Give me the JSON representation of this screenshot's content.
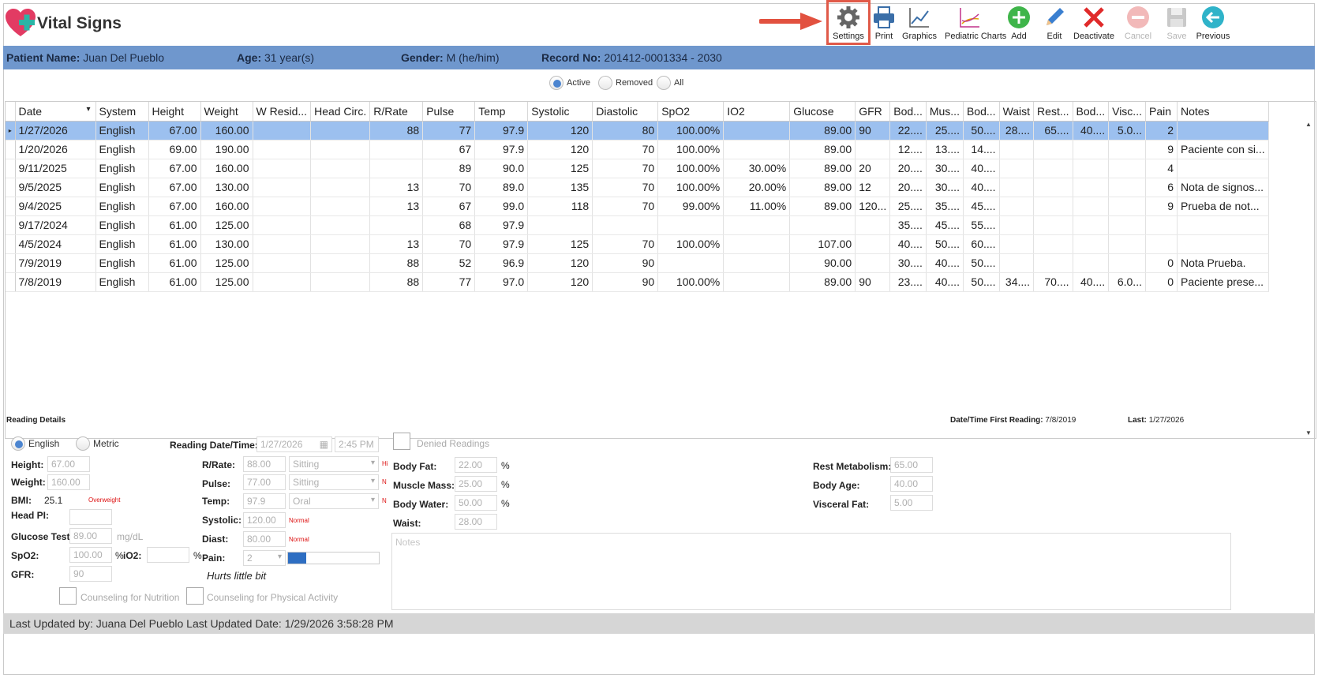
{
  "app": {
    "title": "Vital Signs"
  },
  "toolbar": [
    {
      "label": "Settings",
      "icon": "gear-icon",
      "disabled": false
    },
    {
      "label": "Print",
      "icon": "printer-icon",
      "disabled": false
    },
    {
      "label": "Graphics",
      "icon": "line-chart-icon",
      "disabled": false
    },
    {
      "label": "Pediatric Charts",
      "icon": "pediatric-chart-icon",
      "disabled": false
    },
    {
      "label": "Add",
      "icon": "plus-icon",
      "disabled": false
    },
    {
      "label": "Edit",
      "icon": "pencil-icon",
      "disabled": false
    },
    {
      "label": "Deactivate",
      "icon": "x-icon",
      "disabled": false
    },
    {
      "label": "Cancel",
      "icon": "minus-circle-icon",
      "disabled": true
    },
    {
      "label": "Save",
      "icon": "floppy-icon",
      "disabled": true
    },
    {
      "label": "Previous",
      "icon": "arrow-left-icon",
      "disabled": false
    }
  ],
  "patient": {
    "name_label": "Patient Name:",
    "name": "Juan Del Pueblo",
    "age_label": "Age:",
    "age": "31 year(s)",
    "gender_label": "Gender:",
    "gender": "M (he/him)",
    "record_label": "Record No:",
    "record": "201412-0001334 - 2030"
  },
  "filter": {
    "active": "Active",
    "removed": "Removed",
    "all": "All",
    "selected": "Active"
  },
  "grid": {
    "columns": [
      "Date",
      "System",
      "Height",
      "Weight",
      "W Resid...",
      "Head Circ.",
      "R/Rate",
      "Pulse",
      "Temp",
      "Systolic",
      "Diastolic",
      "SpO2",
      "IO2",
      "Glucose",
      "GFR",
      "Bod...",
      "Mus...",
      "Bod...",
      "Waist",
      "Rest...",
      "Bod...",
      "Visc...",
      "Pain",
      "Notes"
    ],
    "rows": [
      [
        "1/27/2026",
        "English",
        "67.00",
        "160.00",
        "",
        "",
        "88",
        "77",
        "97.9",
        "120",
        "80",
        "100.00%",
        "",
        "89.00",
        "90",
        "22....",
        "25....",
        "50....",
        "28....",
        "65....",
        "40....",
        "5.0...",
        "2",
        ""
      ],
      [
        "1/20/2026",
        "English",
        "69.00",
        "190.00",
        "",
        "",
        "",
        "67",
        "97.9",
        "120",
        "70",
        "100.00%",
        "",
        "89.00",
        "",
        "12....",
        "13....",
        "14....",
        "",
        "",
        "",
        "",
        "9",
        "Paciente con si..."
      ],
      [
        "9/11/2025",
        "English",
        "67.00",
        "160.00",
        "",
        "",
        "",
        "89",
        "90.0",
        "125",
        "70",
        "100.00%",
        "30.00%",
        "89.00",
        "20",
        "20....",
        "30....",
        "40....",
        "",
        "",
        "",
        "",
        "4",
        ""
      ],
      [
        "9/5/2025",
        "English",
        "67.00",
        "130.00",
        "",
        "",
        "13",
        "70",
        "89.0",
        "135",
        "70",
        "100.00%",
        "20.00%",
        "89.00",
        "12",
        "20....",
        "30....",
        "40....",
        "",
        "",
        "",
        "",
        "6",
        "Nota de signos..."
      ],
      [
        "9/4/2025",
        "English",
        "67.00",
        "160.00",
        "",
        "",
        "13",
        "67",
        "99.0",
        "118",
        "70",
        "99.00%",
        "11.00%",
        "89.00",
        "120...",
        "25....",
        "35....",
        "45....",
        "",
        "",
        "",
        "",
        "9",
        "Prueba de not..."
      ],
      [
        "9/17/2024",
        "English",
        "61.00",
        "125.00",
        "",
        "",
        "",
        "68",
        "97.9",
        "",
        "",
        "",
        "",
        "",
        "",
        "35....",
        "45....",
        "55....",
        "",
        "",
        "",
        "",
        "",
        ""
      ],
      [
        "4/5/2024",
        "English",
        "61.00",
        "130.00",
        "",
        "",
        "13",
        "70",
        "97.9",
        "125",
        "70",
        "100.00%",
        "",
        "107.00",
        "",
        "40....",
        "50....",
        "60....",
        "",
        "",
        "",
        "",
        "",
        ""
      ],
      [
        "7/9/2019",
        "English",
        "61.00",
        "125.00",
        "",
        "",
        "88",
        "52",
        "96.9",
        "120",
        "90",
        "",
        "",
        "90.00",
        "",
        "30....",
        "40....",
        "50....",
        "",
        "",
        "",
        "",
        "0",
        "Nota Prueba."
      ],
      [
        "7/8/2019",
        "English",
        "61.00",
        "125.00",
        "",
        "",
        "88",
        "77",
        "97.0",
        "120",
        "90",
        "100.00%",
        "",
        "89.00",
        "90",
        "23....",
        "40....",
        "50....",
        "34....",
        "70....",
        "40....",
        "6.0...",
        "0",
        "Paciente prese..."
      ]
    ]
  },
  "details": {
    "section_title": "Reading Details",
    "first_reading_label": "Date/Time First Reading:",
    "first_reading": "7/8/2019",
    "last_label": "Last:",
    "last": "1/27/2026",
    "system_english": "English",
    "system_metric": "Metric",
    "reading_dt_label": "Reading Date/Time:",
    "reading_date": "1/27/2026",
    "reading_time": "2:45 PM",
    "denied": "Denied Readings",
    "height_label": "Height:",
    "height": "67.00",
    "weight_label": "Weight:",
    "weight": "160.00",
    "bmi_label": "BMI:",
    "bmi": "25.1",
    "bmi_status": "Overweight",
    "headpi_label": "Head PI:",
    "glucose_label": "Glucose Test:",
    "glucose": "89.00",
    "glucose_unit": "mg/dL",
    "spo2_label": "SpO2:",
    "spo2": "100.00",
    "pct": "%",
    "io2_label": "iO2:",
    "gfr_label": "GFR:",
    "gfr": "90",
    "rrate_label": "R/Rate:",
    "rrate": "88.00",
    "rrate_pos": "Sitting",
    "rrate_flag": "Hi",
    "pulse_label": "Pulse:",
    "pulse": "77.00",
    "pulse_pos": "Sitting",
    "pulse_flag": "N",
    "temp_label": "Temp:",
    "temp": "97.9",
    "temp_route": "Oral",
    "temp_flag": "N",
    "systolic_label": "Systolic:",
    "systolic": "120.00",
    "systolic_status": "Normal",
    "diast_label": "Diast:",
    "diast": "80.00",
    "diast_status": "Normal",
    "pain_label": "Pain:",
    "pain": "2",
    "pain_level": 0.2,
    "pain_text": "Hurts little bit",
    "bodyfat_label": "Body Fat:",
    "bodyfat": "22.00",
    "muscle_label": "Muscle Mass:",
    "muscle": "25.00",
    "water_label": "Body Water:",
    "water": "50.00",
    "waist_label": "Waist:",
    "waist": "28.00",
    "notes_placeholder": "Notes",
    "restmeta_label": "Rest Metabolism:",
    "restmeta": "65.00",
    "bodyage_label": "Body Age:",
    "bodyage": "40.00",
    "visceral_label": "Visceral Fat:",
    "visceral": "5.00",
    "counsel_nutrition": "Counseling for Nutrition",
    "counsel_activity": "Counseling for Physical Activity"
  },
  "footer": {
    "updated_by_label": "Last Updated by:",
    "updated_by": "Juana Del Pueblo",
    "updated_date_label": "Last Updated Date:",
    "updated_date": "1/29/2026 3:58:28 PM"
  },
  "colors": {
    "accent": "#6f97cd",
    "selection": "#9cc0ef",
    "highlight": "#e05a49"
  }
}
